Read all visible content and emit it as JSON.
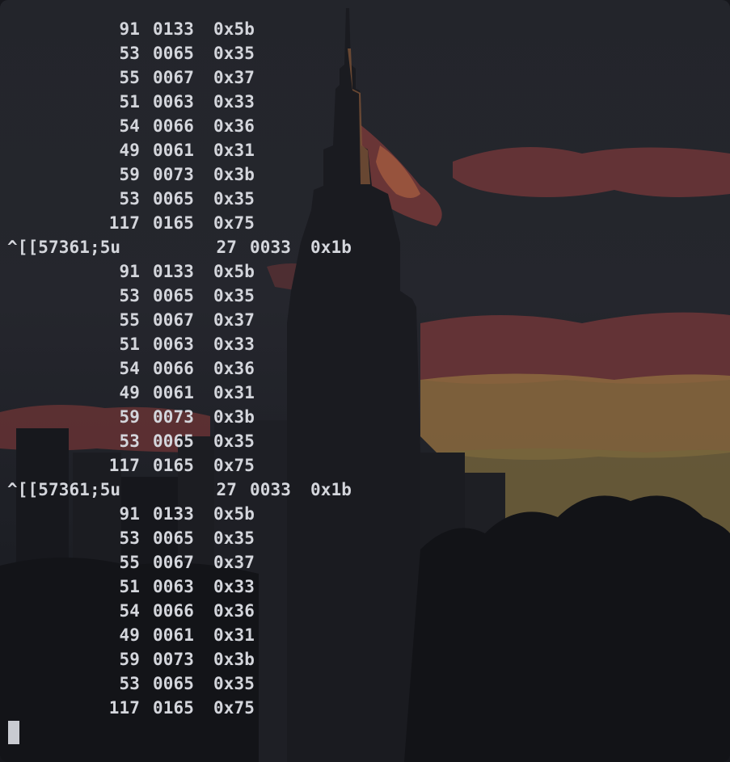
{
  "terminal": {
    "lines": [
      {
        "seq": "",
        "dec": "91",
        "oct": "0133",
        "hex": "0x5b"
      },
      {
        "seq": "",
        "dec": "53",
        "oct": "0065",
        "hex": "0x35"
      },
      {
        "seq": "",
        "dec": "55",
        "oct": "0067",
        "hex": "0x37"
      },
      {
        "seq": "",
        "dec": "51",
        "oct": "0063",
        "hex": "0x33"
      },
      {
        "seq": "",
        "dec": "54",
        "oct": "0066",
        "hex": "0x36"
      },
      {
        "seq": "",
        "dec": "49",
        "oct": "0061",
        "hex": "0x31"
      },
      {
        "seq": "",
        "dec": "59",
        "oct": "0073",
        "hex": "0x3b"
      },
      {
        "seq": "",
        "dec": "53",
        "oct": "0065",
        "hex": "0x35"
      },
      {
        "seq": "",
        "dec": "117",
        "oct": "0165",
        "hex": "0x75"
      },
      {
        "seq": "^[[57361;5u",
        "dec": "27",
        "oct": "0033",
        "hex": "0x1b"
      },
      {
        "seq": "",
        "dec": "91",
        "oct": "0133",
        "hex": "0x5b"
      },
      {
        "seq": "",
        "dec": "53",
        "oct": "0065",
        "hex": "0x35"
      },
      {
        "seq": "",
        "dec": "55",
        "oct": "0067",
        "hex": "0x37"
      },
      {
        "seq": "",
        "dec": "51",
        "oct": "0063",
        "hex": "0x33"
      },
      {
        "seq": "",
        "dec": "54",
        "oct": "0066",
        "hex": "0x36"
      },
      {
        "seq": "",
        "dec": "49",
        "oct": "0061",
        "hex": "0x31"
      },
      {
        "seq": "",
        "dec": "59",
        "oct": "0073",
        "hex": "0x3b"
      },
      {
        "seq": "",
        "dec": "53",
        "oct": "0065",
        "hex": "0x35"
      },
      {
        "seq": "",
        "dec": "117",
        "oct": "0165",
        "hex": "0x75"
      },
      {
        "seq": "^[[57361;5u",
        "dec": "27",
        "oct": "0033",
        "hex": "0x1b"
      },
      {
        "seq": "",
        "dec": "91",
        "oct": "0133",
        "hex": "0x5b"
      },
      {
        "seq": "",
        "dec": "53",
        "oct": "0065",
        "hex": "0x35"
      },
      {
        "seq": "",
        "dec": "55",
        "oct": "0067",
        "hex": "0x37"
      },
      {
        "seq": "",
        "dec": "51",
        "oct": "0063",
        "hex": "0x33"
      },
      {
        "seq": "",
        "dec": "54",
        "oct": "0066",
        "hex": "0x36"
      },
      {
        "seq": "",
        "dec": "49",
        "oct": "0061",
        "hex": "0x31"
      },
      {
        "seq": "",
        "dec": "59",
        "oct": "0073",
        "hex": "0x3b"
      },
      {
        "seq": "",
        "dec": "53",
        "oct": "0065",
        "hex": "0x35"
      },
      {
        "seq": "",
        "dec": "117",
        "oct": "0165",
        "hex": "0x75"
      }
    ],
    "cursor_icon": "block-cursor-icon"
  },
  "colors": {
    "background": "#23252b",
    "foreground": "#d4d6dc",
    "cursor": "#c9cbd1"
  },
  "wallpaper": {
    "subject": "city skyline at sunset"
  }
}
